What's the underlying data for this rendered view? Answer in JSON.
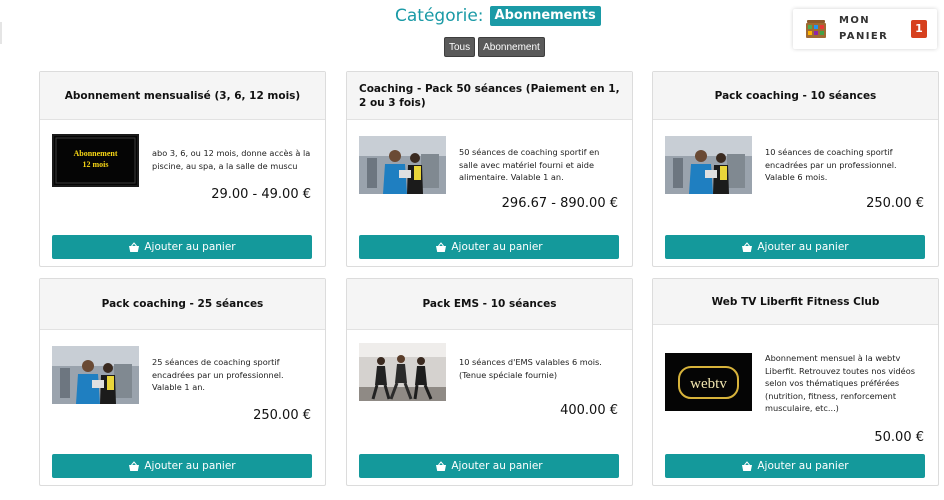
{
  "category": {
    "label": "Catégorie:",
    "selected": "Abonnements"
  },
  "filters": [
    {
      "label": "Tous"
    },
    {
      "label": "Abonnement"
    }
  ],
  "cart": {
    "label_line1": "MON",
    "label_line2": "PANIER",
    "count": "1",
    "icon": "basket-icon"
  },
  "products": [
    {
      "title": "Abonnement mensualisé (3, 6, 12 mois)",
      "description": "abo 3, 6, ou 12 mois, donne accès à la piscine, au spa, a la salle de muscu",
      "price": "29.00 - 49.00 €",
      "image_text_1": "Abonnement",
      "image_text_2": "12 mois",
      "button": "Ajouter au panier"
    },
    {
      "title": "Coaching - Pack 50 séances (Paiement en 1, 2 ou 3 fois)",
      "description": "50 séances de coaching sportif en salle avec matériel fourni et aide alimentaire. Valable 1 an.",
      "price": "296.67 - 890.00 €",
      "button": "Ajouter au panier"
    },
    {
      "title": "Pack coaching - 10 séances",
      "description": "10 séances de coaching sportif encadrées par un professionnel. Valable 6 mois.",
      "price": "250.00 €",
      "button": "Ajouter au panier"
    },
    {
      "title": "Pack coaching - 25 séances",
      "description": "25 séances de coaching sportif encadrées par un professionnel. Valable 1 an.",
      "price": "250.00 €",
      "button": "Ajouter au panier"
    },
    {
      "title": "Pack EMS - 10 séances",
      "description": "10 séances d'EMS valables 6 mois. (Tenue spéciale fournie)",
      "price": "400.00 €",
      "button": "Ajouter au panier"
    },
    {
      "title": "Web TV Liberfit Fitness Club",
      "description": "Abonnement mensuel à la webtv Liberfit. Retrouvez toutes nos vidéos selon vos thématiques préférées (nutrition, fitness, renforcement musculaire, etc...)",
      "price": "50.00 €",
      "image_text_1": "webtv",
      "button": "Ajouter au panier"
    }
  ],
  "colors": {
    "accent": "#1a9aa6",
    "button": "#14999b",
    "cart_badge": "#d6401e",
    "filter": "#5a5a5a"
  }
}
